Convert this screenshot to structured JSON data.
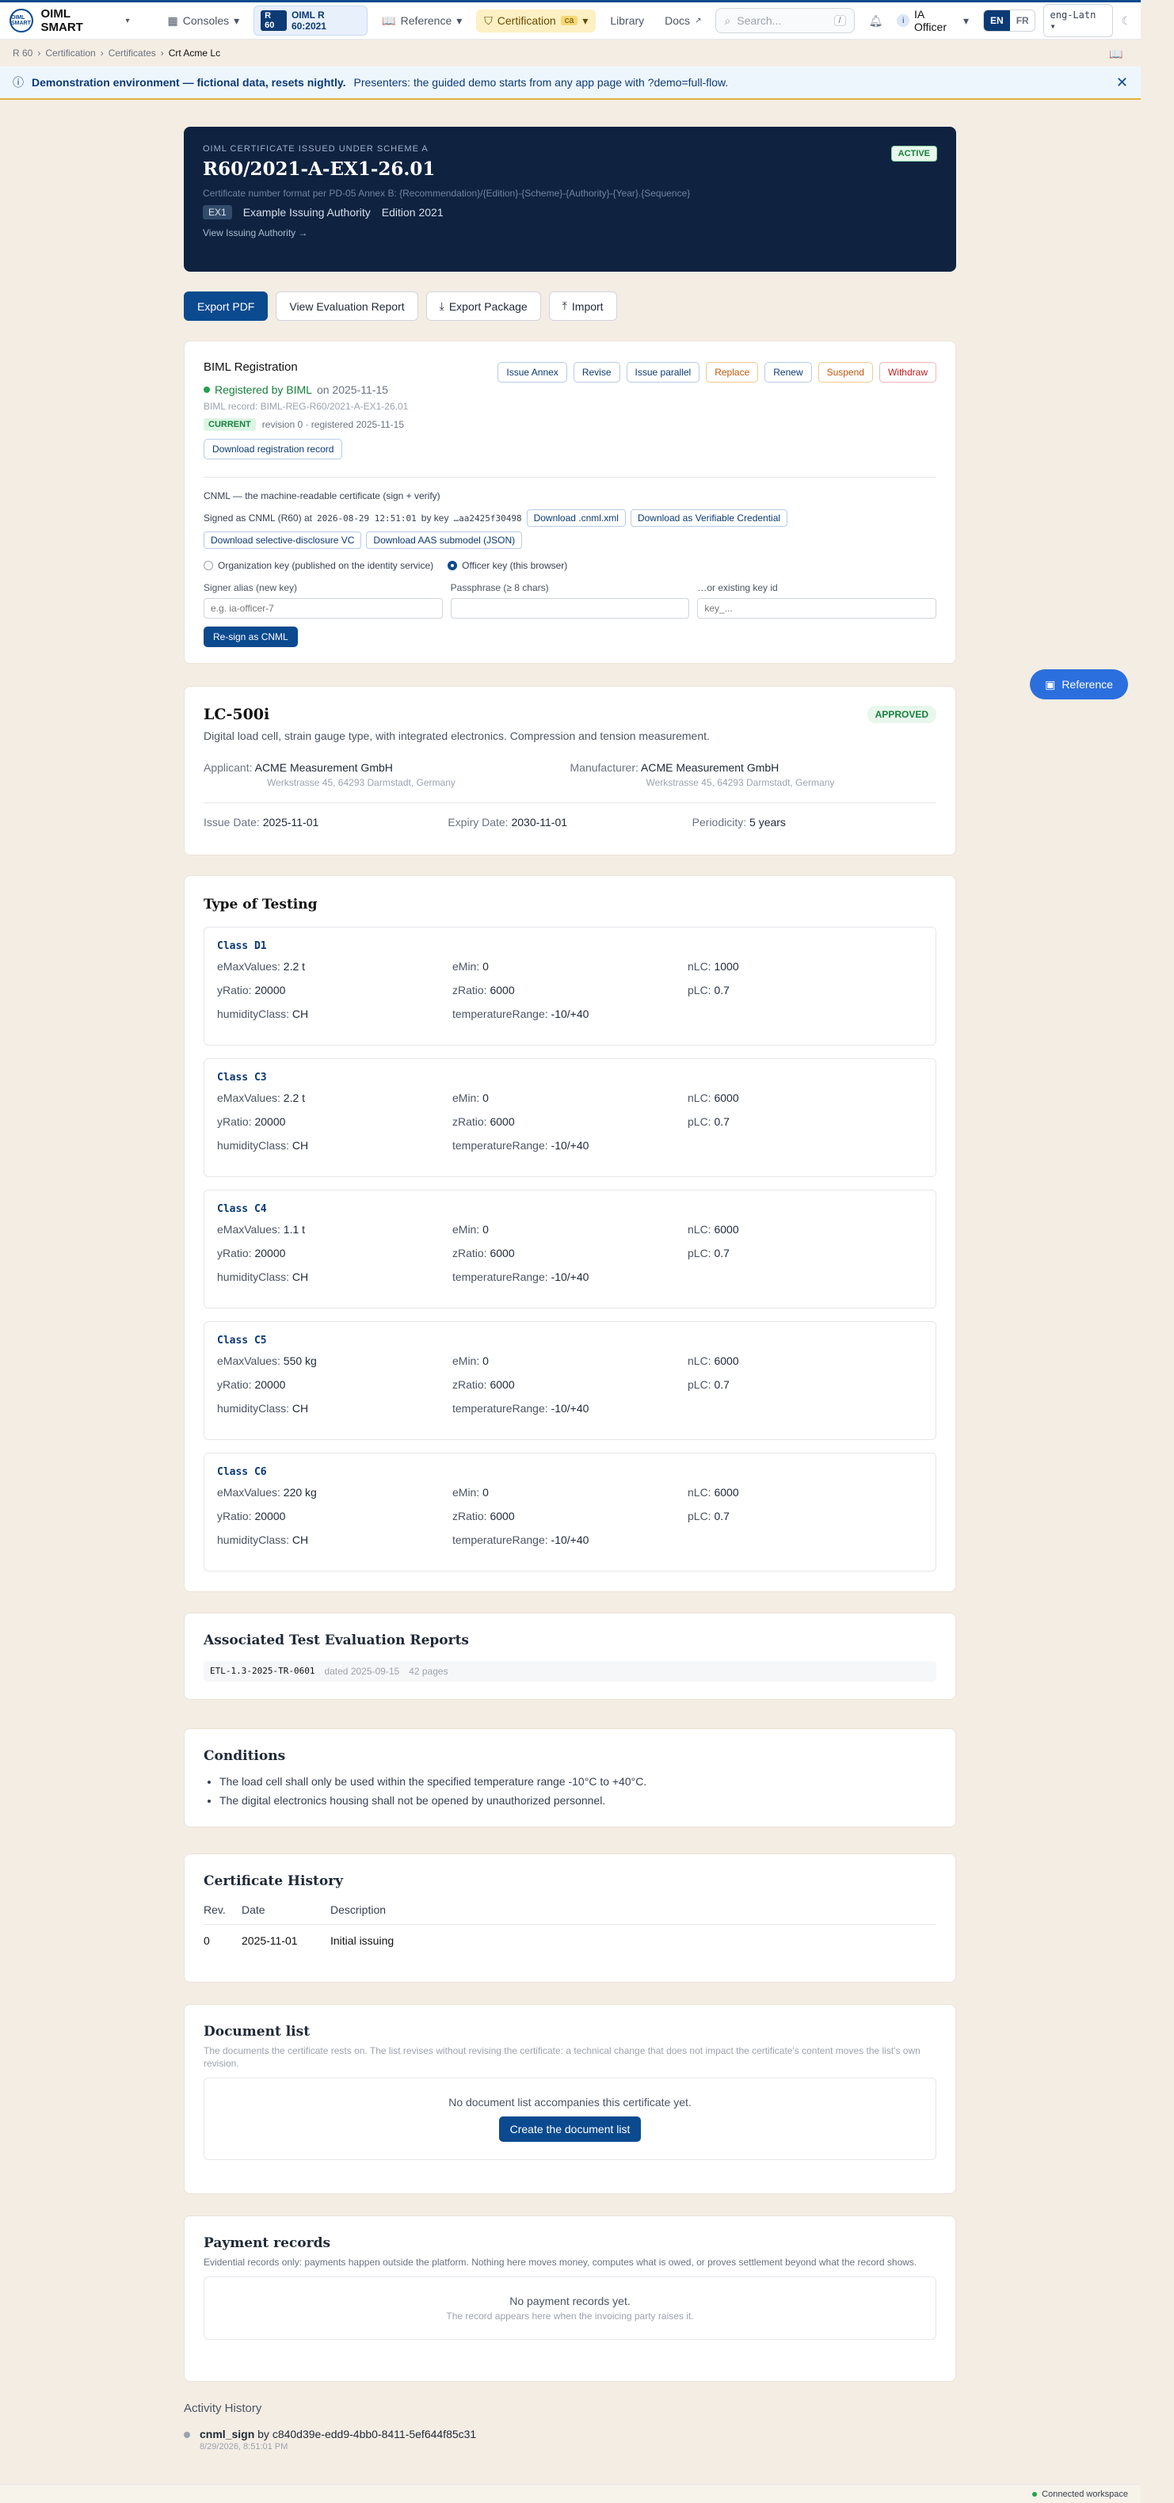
{
  "nav": {
    "brand": "OIML SMART",
    "logo_text": "OIML SMART",
    "consoles": "Consoles",
    "rec_tag": "R 60",
    "rec_label": "OIML R 60:2021",
    "reference": "Reference",
    "certification": "Certification",
    "cert_badge": "ca",
    "library": "Library",
    "docs": "Docs",
    "search_placeholder": "Search...",
    "search_kbd": "/",
    "user": "IA Officer",
    "lang_en": "EN",
    "lang_fr": "FR",
    "script": "eng-Latn"
  },
  "breadcrumbs": [
    "R 60",
    "Certification",
    "Certificates",
    "Crt Acme Lc"
  ],
  "banner": {
    "bold": "Demonstration environment — fictional data, resets nightly.",
    "text": "Presenters: the guided demo starts from any app page with ?demo=full-flow."
  },
  "hero": {
    "eyebrow": "OIML CERTIFICATE ISSUED UNDER SCHEME A",
    "cert_no": "R60/2021-A-EX1-26.01",
    "format": "Certificate number format per PD-05 Annex B: {Recommendation}/{Edition}-{Scheme}-{Authority}-{Year}.{Sequence}",
    "authority_code": "EX1",
    "authority": "Example Issuing Authority",
    "edition": "Edition 2021",
    "view_link": "View Issuing Authority →",
    "status": "ACTIVE"
  },
  "actions": {
    "export_pdf": "Export PDF",
    "view_report": "View Evaluation Report",
    "export_package": "Export Package",
    "import": "Import"
  },
  "biml": {
    "title": "BIML Registration",
    "registered": "Registered by BIML",
    "on_date": "on 2025-11-15",
    "record": "BIML record: BIML-REG-R60/2021-A-EX1-26.01",
    "current": "CURRENT",
    "revision": "revision 0 · registered 2025-11-15",
    "download_record": "Download registration record",
    "buttons": {
      "issue_annex": "Issue Annex",
      "revise": "Revise",
      "issue_parallel": "Issue parallel",
      "replace": "Replace",
      "renew": "Renew",
      "suspend": "Suspend",
      "withdraw": "Withdraw"
    },
    "cnml_title": "CNML — the machine-readable certificate (sign + verify)",
    "signed_prefix": "Signed as CNML (R60) at",
    "signed_time": "2026-08-29 12:51:01",
    "by_key": "by key",
    "key_id": "…aa2425f30498",
    "dl_cnml": "Download .cnml.xml",
    "dl_vc": "Download as Verifiable Credential",
    "dl_sd_vc": "Download selective-disclosure VC",
    "dl_aas": "Download AAS submodel (JSON)",
    "radio_org": "Organization key (published on the identity service)",
    "radio_officer": "Officer key (this browser)",
    "alias_label": "Signer alias (new key)",
    "alias_placeholder": "e.g. ia-officer-7",
    "pass_label": "Passphrase (≥ 8 chars)",
    "pass_placeholder": "",
    "existing_label": "…or existing key id",
    "existing_placeholder": "key_...",
    "resign": "Re-sign as CNML"
  },
  "floating": {
    "reference": "Reference"
  },
  "product": {
    "model": "LC-500i",
    "status": "APPROVED",
    "description": "Digital load cell, strain gauge type, with integrated electronics. Compression and tension measurement.",
    "applicant_label": "Applicant:",
    "applicant": "ACME Measurement GmbH",
    "applicant_addr": "Werkstrasse 45, 64293 Darmstadt, Germany",
    "manufacturer_label": "Manufacturer:",
    "manufacturer": "ACME Measurement GmbH",
    "manufacturer_addr": "Werkstrasse 45, 64293 Darmstadt, Germany",
    "issue_label": "Issue Date:",
    "issue_date": "2025-11-01",
    "expiry_label": "Expiry Date:",
    "expiry_date": "2030-11-01",
    "periodicity_label": "Periodicity:",
    "periodicity": "5 years"
  },
  "testing": {
    "title": "Type of Testing",
    "keys": [
      "eMaxValues:",
      "eMin:",
      "nLC:",
      "yRatio:",
      "zRatio:",
      "pLC:",
      "humidityClass:",
      "temperatureRange:"
    ],
    "classes": [
      {
        "name": "Class D1",
        "values": [
          "2.2 t",
          "0",
          "1000",
          "20000",
          "6000",
          "0.7",
          "CH",
          "-10/+40"
        ]
      },
      {
        "name": "Class C3",
        "values": [
          "2.2 t",
          "0",
          "6000",
          "20000",
          "6000",
          "0.7",
          "CH",
          "-10/+40"
        ]
      },
      {
        "name": "Class C4",
        "values": [
          "1.1 t",
          "0",
          "6000",
          "20000",
          "6000",
          "0.7",
          "CH",
          "-10/+40"
        ]
      },
      {
        "name": "Class C5",
        "values": [
          "550 kg",
          "0",
          "6000",
          "20000",
          "6000",
          "0.7",
          "CH",
          "-10/+40"
        ]
      },
      {
        "name": "Class C6",
        "values": [
          "220 kg",
          "0",
          "6000",
          "20000",
          "6000",
          "0.7",
          "CH",
          "-10/+40"
        ]
      }
    ]
  },
  "reports": {
    "title": "Associated Test Evaluation Reports",
    "id": "ETL-1.3-2025-TR-0601",
    "dated": "dated 2025-09-15",
    "pages": "42 pages"
  },
  "conditions": {
    "title": "Conditions",
    "items": [
      "The load cell shall only be used within the specified temperature range -10°C to +40°C.",
      "The digital electronics housing shall not be opened by unauthorized personnel."
    ]
  },
  "history": {
    "title": "Certificate History",
    "headers": [
      "Rev.",
      "Date",
      "Description"
    ],
    "rows": [
      [
        "0",
        "2025-11-01",
        "Initial issuing"
      ]
    ]
  },
  "document_list": {
    "title": "Document list",
    "subtitle": "The documents the certificate rests on. The list revises without revising the certificate: a technical change that does not impact the certificate's content moves the list's own revision.",
    "empty": "No document list accompanies this certificate yet.",
    "create": "Create the document list"
  },
  "payments": {
    "title": "Payment records",
    "subtitle": "Evidential records only: payments happen outside the platform. Nothing here moves money, computes what is owed, or proves settlement beyond what the record shows.",
    "empty": "No payment records yet.",
    "empty_sub": "The record appears here when the invoicing party raises it."
  },
  "activity": {
    "title": "Activity History",
    "event": "cnml_sign",
    "by": "by c840d39e-edd9-4bb0-8411-5ef644f85c31",
    "when": "8/29/2026, 8:51:01 PM"
  },
  "footer": {
    "status": "Connected workspace"
  }
}
